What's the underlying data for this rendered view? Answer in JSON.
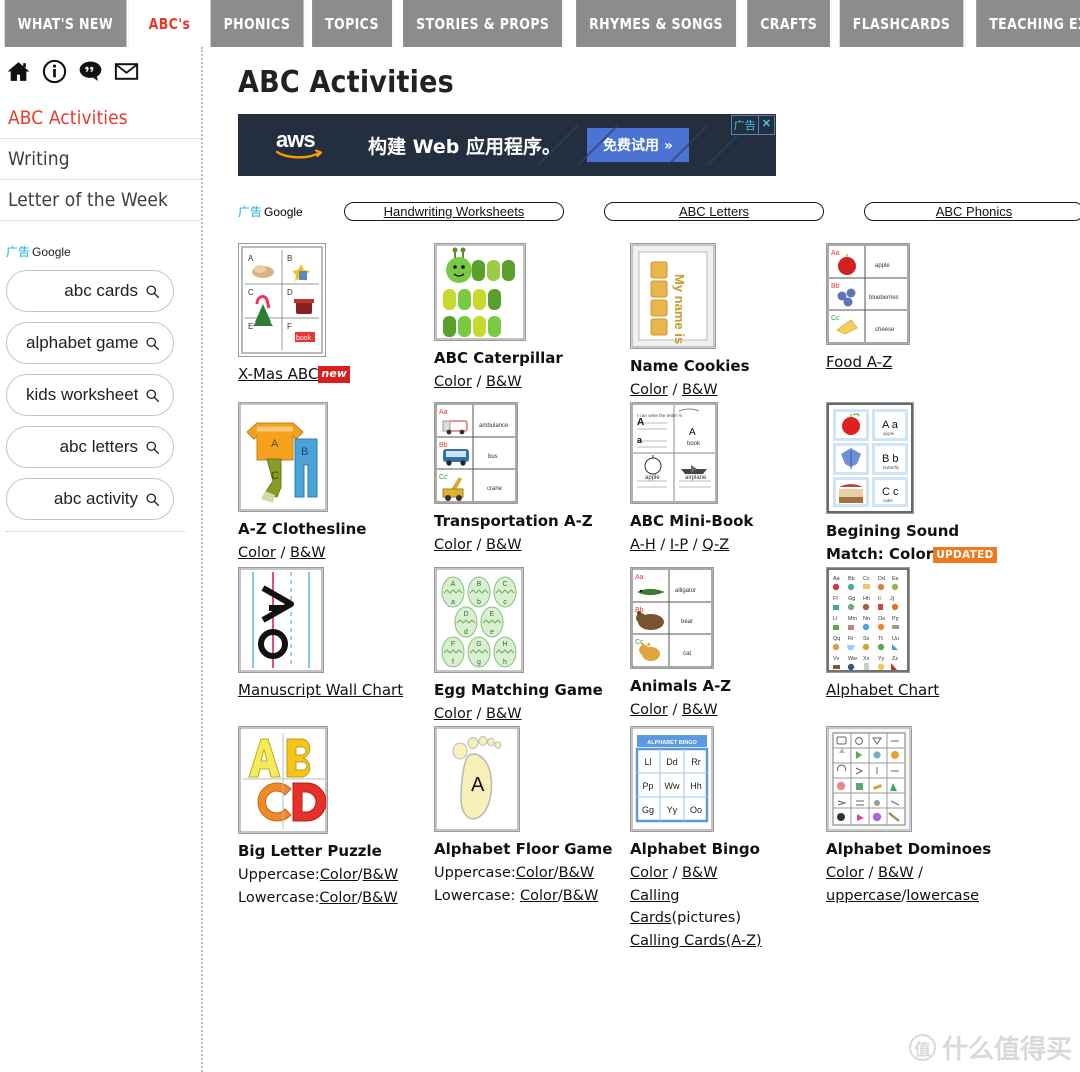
{
  "topnav": {
    "tabs": [
      {
        "label": "WHAT'S NEW",
        "active": false
      },
      {
        "label": "ABC's",
        "active": true
      },
      {
        "label": "PHONICS",
        "active": false
      },
      {
        "label": "TOPICS",
        "active": false
      },
      {
        "label": "STORIES & PROPS",
        "active": false
      },
      {
        "label": "RHYMES & SONGS",
        "active": false
      },
      {
        "label": "CRAFTS",
        "active": false
      },
      {
        "label": "FLASHCARDS",
        "active": false
      },
      {
        "label": "TEACHING EXTRAS",
        "active": false
      }
    ]
  },
  "sidebar": {
    "icons": [
      "home-icon",
      "info-icon",
      "comment-icon",
      "mail-icon"
    ],
    "links": [
      {
        "label": "ABC Activities",
        "current": true
      },
      {
        "label": "Writing",
        "current": false
      },
      {
        "label": "Letter of the Week",
        "current": false
      }
    ],
    "ad": {
      "tag_cn": "广告",
      "provider": "Google",
      "pills": [
        {
          "text": "abc cards"
        },
        {
          "text": "alphabet game"
        },
        {
          "text": "kids worksheet"
        },
        {
          "text": "abc letters"
        },
        {
          "text": "abc activity"
        }
      ]
    }
  },
  "main": {
    "page_title": "ABC Activities",
    "banner": {
      "brand": "aws",
      "headline": "构建 Web 应用程序。",
      "cta": "免费试用 »",
      "ad_tag": "广告",
      "close": "✕",
      "bg_color": "#232f3e",
      "cta_color": "#4a73d4"
    },
    "ad_row": {
      "tag_cn": "广告",
      "provider": "Google",
      "pills": [
        "Handwriting Worksheets",
        "ABC Letters",
        "ABC Phonics"
      ]
    },
    "grid": {
      "rows": [
        [
          {
            "thumb": "xmas-abc-grid",
            "title": "X-Mas ABC",
            "title_is_link": true,
            "badge": "new",
            "badge_type": "new",
            "links": []
          },
          {
            "thumb": "abc-caterpillar",
            "title": "ABC Caterpillar",
            "title_is_link": false,
            "links": [
              {
                "text": "Color / B&W"
              }
            ]
          },
          {
            "thumb": "name-cookies",
            "title": "Name Cookies",
            "title_is_link": false,
            "links": [
              {
                "text": "Color / B&W"
              }
            ]
          },
          {
            "thumb": "food-az",
            "title": "Food A-Z",
            "title_is_link": true,
            "links": []
          }
        ],
        [
          {
            "thumb": "az-clothesline",
            "title": "A-Z Clothesline",
            "title_is_link": false,
            "links": [
              {
                "text": "Color / B&W"
              }
            ]
          },
          {
            "thumb": "transportation-az",
            "title": "Transportation A-Z",
            "title_is_link": false,
            "links": [
              {
                "text": "Color / B&W"
              }
            ]
          },
          {
            "thumb": "abc-mini-book",
            "title": "ABC Mini-Book",
            "title_is_link": false,
            "links": [
              {
                "text": "A-H / I-P / Q-Z"
              }
            ]
          },
          {
            "thumb": "begining-sound-match",
            "title": "Begining Sound",
            "title_line2": "Match: Color",
            "title_is_link": false,
            "badge": "UPDATED",
            "badge_type": "updated",
            "links": []
          }
        ],
        [
          {
            "thumb": "manuscript-wall-chart",
            "title": "Manuscript Wall Chart",
            "title_is_link": true,
            "links": []
          },
          {
            "thumb": "egg-matching-game",
            "title": "Egg Matching Game",
            "title_is_link": false,
            "links": [
              {
                "text": "Color / B&W"
              }
            ]
          },
          {
            "thumb": "animals-az",
            "title": "Animals A-Z",
            "title_is_link": false,
            "links": [
              {
                "text": "Color / B&W"
              }
            ]
          },
          {
            "thumb": "alphabet-chart",
            "title": "Alphabet Chart",
            "title_is_link": true,
            "links": []
          }
        ],
        [
          {
            "thumb": "big-letter-puzzle",
            "title": "Big Letter Puzzle",
            "title_is_link": false,
            "links": [
              {
                "text": "Uppercase:Color/B&W"
              },
              {
                "text": "Lowercase:Color/B&W"
              }
            ]
          },
          {
            "thumb": "alphabet-floor-game",
            "title": "Alphabet Floor Game",
            "title_is_link": false,
            "links": [
              {
                "text": "Uppercase:Color/B&W"
              },
              {
                "text": "Lowercase: Color/B&W"
              }
            ]
          },
          {
            "thumb": "alphabet-bingo",
            "title": "Alphabet Bingo",
            "title_is_link": false,
            "links": [
              {
                "text": "Color / B&W"
              },
              {
                "text": "Calling"
              },
              {
                "text": "Cards(pictures)"
              },
              {
                "text": "Calling Cards(A-Z)"
              }
            ]
          },
          {
            "thumb": "alphabet-dominoes",
            "title": "Alphabet Dominoes",
            "title_is_link": false,
            "links": [
              {
                "text": "Color / B&W /"
              },
              {
                "text": "uppercase/lowercase"
              }
            ]
          }
        ]
      ]
    }
  },
  "watermark": {
    "mark": "值",
    "text": "什么值得买"
  },
  "colors": {
    "tab_inactive_bg": "#8c8c8c",
    "accent_red": "#e8392a",
    "badge_new": "#d81f20",
    "badge_updated": "#f0781e",
    "ad_cn_blue": "#14b0d6"
  }
}
